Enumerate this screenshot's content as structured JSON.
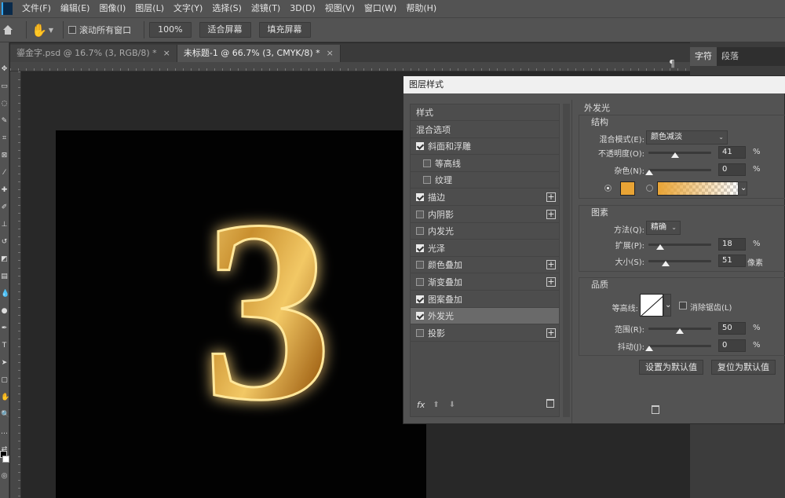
{
  "menu": [
    "文件(F)",
    "编辑(E)",
    "图像(I)",
    "图层(L)",
    "文字(Y)",
    "选择(S)",
    "滤镜(T)",
    "3D(D)",
    "视图(V)",
    "窗口(W)",
    "帮助(H)"
  ],
  "options_bar": {
    "scroll_all": "滚动所有窗口",
    "zoom_100": "100%",
    "fit_screen": "适合屏幕",
    "fill_screen": "填充屏幕"
  },
  "tabs": [
    {
      "label": "鎏金字.psd @ 16.7% (3, RGB/8) *",
      "close": "×"
    },
    {
      "label": "未标题-1 @ 66.7% (3, CMYK/8) *",
      "close": "×"
    }
  ],
  "right_panel": {
    "tab1": "字符",
    "tab2": "段落"
  },
  "artwork": {
    "glyph": "3"
  },
  "dialog": {
    "title": "图层样式",
    "styles": [
      {
        "label": "样式",
        "checkbox": false,
        "checked": false,
        "plus": false,
        "indent": false
      },
      {
        "label": "混合选项",
        "checkbox": false,
        "checked": false,
        "plus": false,
        "indent": false
      },
      {
        "label": "斜面和浮雕",
        "checkbox": true,
        "checked": true,
        "plus": false,
        "indent": false
      },
      {
        "label": "等高线",
        "checkbox": true,
        "checked": false,
        "plus": false,
        "indent": true
      },
      {
        "label": "纹理",
        "checkbox": true,
        "checked": false,
        "plus": false,
        "indent": true
      },
      {
        "label": "描边",
        "checkbox": true,
        "checked": true,
        "plus": true,
        "indent": false
      },
      {
        "label": "内阴影",
        "checkbox": true,
        "checked": false,
        "plus": true,
        "indent": false
      },
      {
        "label": "内发光",
        "checkbox": true,
        "checked": false,
        "plus": false,
        "indent": false
      },
      {
        "label": "光泽",
        "checkbox": true,
        "checked": true,
        "plus": false,
        "indent": false
      },
      {
        "label": "颜色叠加",
        "checkbox": true,
        "checked": false,
        "plus": true,
        "indent": false
      },
      {
        "label": "渐变叠加",
        "checkbox": true,
        "checked": false,
        "plus": true,
        "indent": false
      },
      {
        "label": "图案叠加",
        "checkbox": true,
        "checked": true,
        "plus": false,
        "indent": false
      },
      {
        "label": "外发光",
        "checkbox": true,
        "checked": true,
        "plus": false,
        "indent": false,
        "selected": true
      },
      {
        "label": "投影",
        "checkbox": true,
        "checked": false,
        "plus": true,
        "indent": false
      }
    ],
    "fx": "fx",
    "outer_glow": {
      "heading": "外发光",
      "structure": {
        "heading": "结构",
        "blend_mode_label": "混合模式(E):",
        "blend_mode_value": "颜色减淡",
        "opacity_label": "不透明度(O):",
        "opacity_value": "41",
        "opacity_unit": "%",
        "noise_label": "杂色(N):",
        "noise_value": "0",
        "noise_unit": "%",
        "glow_color": "#e9a435",
        "gradient_color": "#e9a435"
      },
      "elements": {
        "heading": "图素",
        "method_label": "方法(Q):",
        "method_value": "精确",
        "spread_label": "扩展(P):",
        "spread_value": "18",
        "spread_unit": "%",
        "size_label": "大小(S):",
        "size_value": "51",
        "size_unit": "像素"
      },
      "quality": {
        "heading": "品质",
        "contour_label": "等高线:",
        "antialias_label": "消除锯齿(L)",
        "range_label": "范围(R):",
        "range_value": "50",
        "range_unit": "%",
        "jitter_label": "抖动(J):",
        "jitter_value": "0",
        "jitter_unit": "%"
      },
      "make_default": "设置为默认值",
      "reset_default": "复位为默认值"
    }
  }
}
